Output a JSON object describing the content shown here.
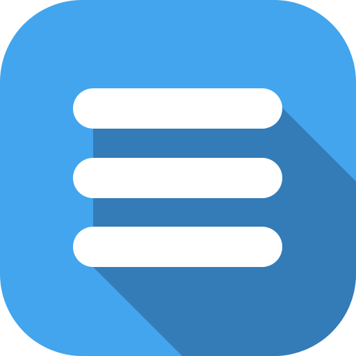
{
  "icon": {
    "name": "hamburger-menu-icon",
    "colors": {
      "background": "#42A5EE",
      "long_shadow": "#337CB7",
      "bars": "#FFFFFF"
    },
    "bar_count": 3
  }
}
